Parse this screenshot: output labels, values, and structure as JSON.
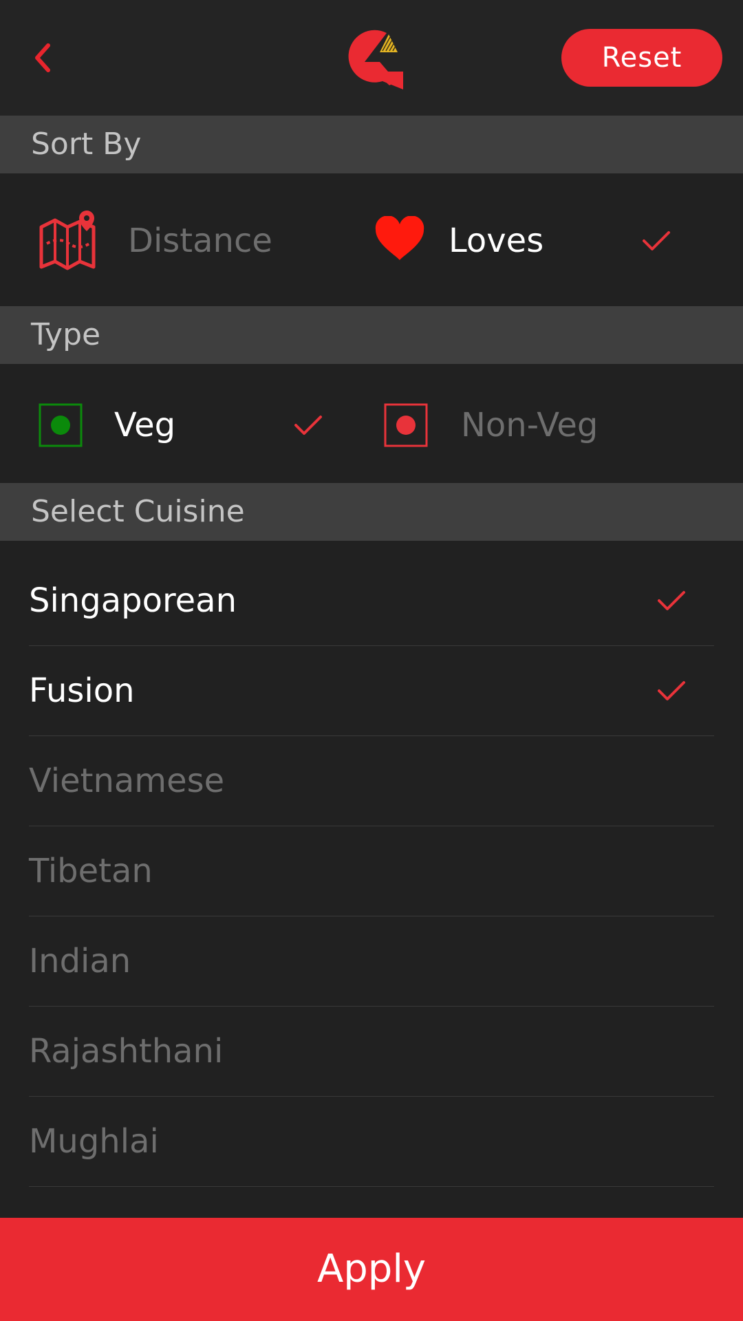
{
  "header": {
    "reset_label": "Reset"
  },
  "sort_by": {
    "title": "Sort By",
    "options": [
      {
        "label": "Distance",
        "selected": false,
        "icon": "map-pin-icon"
      },
      {
        "label": "Loves",
        "selected": true,
        "icon": "heart-icon"
      }
    ]
  },
  "type": {
    "title": "Type",
    "options": [
      {
        "label": "Veg",
        "selected": true,
        "icon": "veg-icon"
      },
      {
        "label": "Non-Veg",
        "selected": false,
        "icon": "non-veg-icon"
      }
    ]
  },
  "cuisine": {
    "title": "Select Cuisine",
    "items": [
      {
        "label": "Singaporean",
        "selected": true
      },
      {
        "label": "Fusion",
        "selected": true
      },
      {
        "label": "Vietnamese",
        "selected": false
      },
      {
        "label": "Tibetan",
        "selected": false
      },
      {
        "label": "Indian",
        "selected": false
      },
      {
        "label": "Rajashthani",
        "selected": false
      },
      {
        "label": "Mughlai",
        "selected": false
      }
    ]
  },
  "footer": {
    "apply_label": "Apply"
  },
  "colors": {
    "accent": "#ea2a32",
    "background": "#212121",
    "section_header": "#3f3f3f",
    "veg_green": "#0b8a0b",
    "selected_text": "#ffffff",
    "unselected_text": "#6e6e6e"
  }
}
